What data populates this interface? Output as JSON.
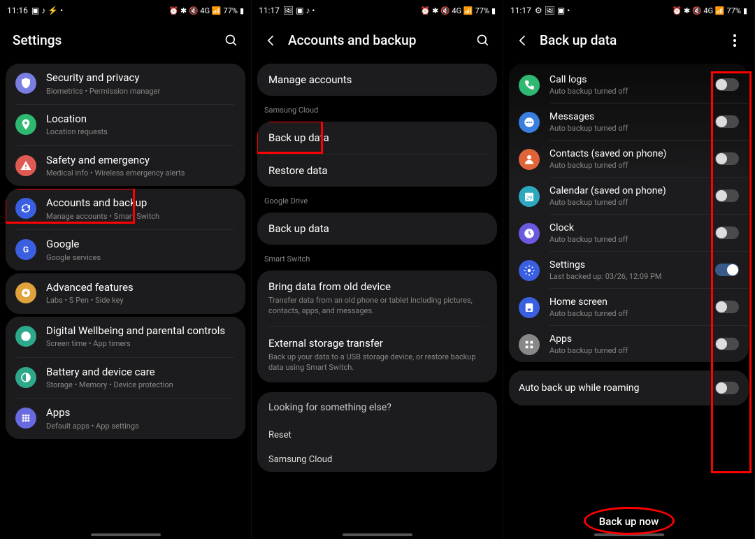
{
  "status": {
    "time1": "11:16",
    "time2": "11:17",
    "time3": "11:17",
    "battery": "77%",
    "net": "4G"
  },
  "screen1": {
    "title": "Settings",
    "groups": [
      {
        "items": [
          {
            "icon": "shield",
            "color": "#7a7ee0",
            "title": "Security and privacy",
            "sub": "Biometrics  •  Permission manager"
          },
          {
            "icon": "pin",
            "color": "#2eb872",
            "title": "Location",
            "sub": "Location requests"
          },
          {
            "icon": "alert",
            "color": "#e05a54",
            "title": "Safety and emergency",
            "sub": "Medical info  •  Wireless emergency alerts"
          }
        ]
      },
      {
        "items": [
          {
            "icon": "sync",
            "color": "#3a5fe0",
            "title": "Accounts and backup",
            "sub": "Manage accounts  •  Smart Switch",
            "highlight": true
          },
          {
            "icon": "google",
            "color": "#3a5fe0",
            "title": "Google",
            "sub": "Google services"
          }
        ]
      },
      {
        "items": [
          {
            "icon": "star",
            "color": "#e0a23a",
            "title": "Advanced features",
            "sub": "Labs  •  S Pen  •  Side key"
          }
        ]
      },
      {
        "items": [
          {
            "icon": "wellbeing",
            "color": "#2ea88a",
            "title": "Digital Wellbeing and parental controls",
            "sub": "Screen time  •  App timers"
          },
          {
            "icon": "battery",
            "color": "#2ea88a",
            "title": "Battery and device care",
            "sub": "Storage  •  Memory  •  Device protection"
          },
          {
            "icon": "apps",
            "color": "#6a6ae0",
            "title": "Apps",
            "sub": "Default apps  •  App settings"
          }
        ]
      }
    ]
  },
  "screen2": {
    "title": "Accounts and backup",
    "manage": "Manage accounts",
    "sec_samsung": "Samsung Cloud",
    "backup": "Back up data",
    "restore": "Restore data",
    "sec_drive": "Google Drive",
    "drive_backup": "Back up data",
    "sec_switch": "Smart Switch",
    "bring_title": "Bring data from old device",
    "bring_sub": "Transfer data from an old phone or tablet including pictures, contacts, apps, and messages.",
    "ext_title": "External storage transfer",
    "ext_sub": "Back up your data to a USB storage device, or restore backup data using Smart Switch.",
    "looking": "Looking for something else?",
    "reset": "Reset",
    "samsung_cloud": "Samsung Cloud"
  },
  "screen3": {
    "title": "Back up data",
    "items": [
      {
        "icon": "phone",
        "color": "#2eb872",
        "title": "Call logs",
        "sub": "Auto backup turned off",
        "on": false
      },
      {
        "icon": "msg",
        "color": "#3a7ee0",
        "title": "Messages",
        "sub": "Auto backup turned off",
        "on": false
      },
      {
        "icon": "person",
        "color": "#e0643a",
        "title": "Contacts (saved on phone)",
        "sub": "Auto backup turned off",
        "on": false
      },
      {
        "icon": "cal",
        "color": "#2ea8c0",
        "title": "Calendar (saved on phone)",
        "sub": "Auto backup turned off",
        "on": false
      },
      {
        "icon": "clock",
        "color": "#6a5ae0",
        "title": "Clock",
        "sub": "Auto backup turned off",
        "on": false
      },
      {
        "icon": "gear",
        "color": "#3a5fe0",
        "title": "Settings",
        "sub": "Last backed up: 03/26, 12:09 PM",
        "on": true
      },
      {
        "icon": "home",
        "color": "#3a5fe0",
        "title": "Home screen",
        "sub": "Auto backup turned off",
        "on": false
      },
      {
        "icon": "grid",
        "color": "#888",
        "title": "Apps",
        "sub": "Auto backup turned off",
        "on": false
      }
    ],
    "roaming": "Auto back up while roaming",
    "button": "Back up now"
  }
}
